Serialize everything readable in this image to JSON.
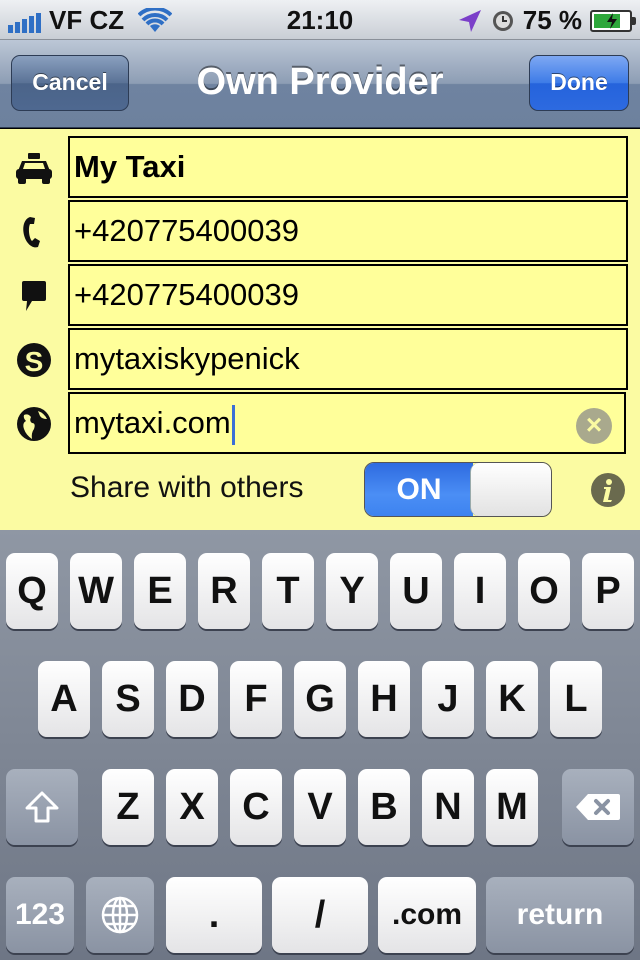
{
  "status_bar": {
    "carrier": "VF CZ",
    "time": "21:10",
    "battery_percent": "75 %",
    "battery_level": 0.75,
    "icons": [
      "signal-icon",
      "wifi-icon",
      "location-icon",
      "alarm-icon",
      "battery-charging-icon"
    ]
  },
  "nav": {
    "title": "Own Provider",
    "cancel_label": "Cancel",
    "done_label": "Done"
  },
  "form": {
    "name": {
      "value": "My Taxi",
      "icon": "taxi-icon"
    },
    "phone": {
      "value": "+420775400039",
      "icon": "phone-icon"
    },
    "sms": {
      "value": "+420775400039",
      "icon": "speech-bubble-icon"
    },
    "skype": {
      "value": "mytaxiskypenick",
      "icon": "skype-icon"
    },
    "web": {
      "value": "mytaxi.com",
      "icon": "globe-icon"
    },
    "share_label": "Share with others",
    "share_toggle": "ON",
    "share_on": true
  },
  "keyboard": {
    "row1": [
      "Q",
      "W",
      "E",
      "R",
      "T",
      "Y",
      "U",
      "I",
      "O",
      "P"
    ],
    "row2": [
      "A",
      "S",
      "D",
      "F",
      "G",
      "H",
      "J",
      "K",
      "L"
    ],
    "row3": [
      "Z",
      "X",
      "C",
      "V",
      "B",
      "N",
      "M"
    ],
    "numbers_key": "123",
    "dot_key": ".",
    "slash_key": "/",
    "dotcom_key": ".com",
    "return_key": "return"
  },
  "colors": {
    "form_bg": "#fbfba2",
    "accent_blue": "#2563dc",
    "nav_blue": "#6f83a0"
  }
}
